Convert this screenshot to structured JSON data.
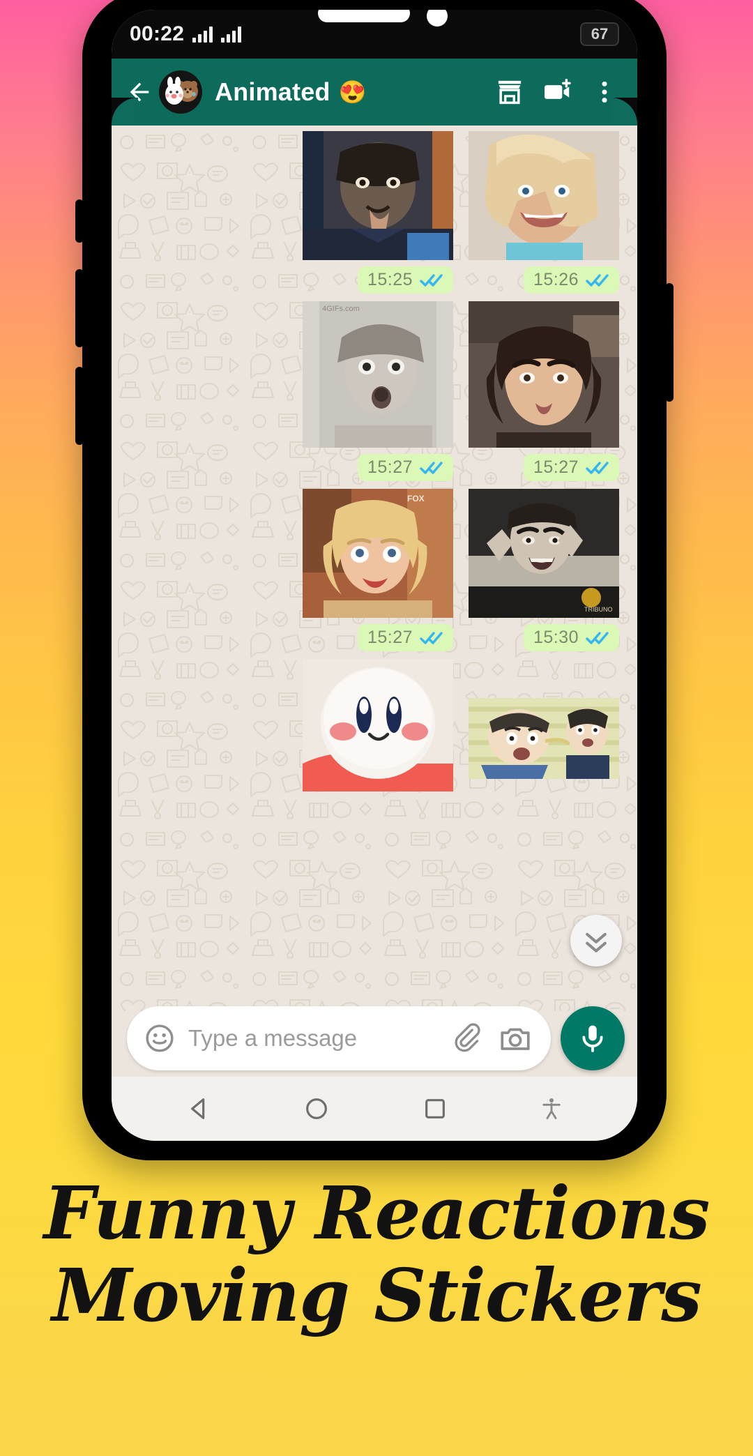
{
  "status_bar": {
    "clock": "00:22",
    "battery": "67",
    "signal_icon": "signal-bars-icon",
    "signal_icon_2": "signal-bars-icon"
  },
  "app_bar": {
    "back_icon": "back-arrow-icon",
    "avatar_name": "avatar",
    "title": "Animated",
    "title_emoji": "😍",
    "actions": [
      {
        "name": "sticker-store-icon",
        "label": "Store"
      },
      {
        "name": "video-call-add-icon",
        "label": "Video call"
      },
      {
        "name": "overflow-menu-icon",
        "label": "More options"
      }
    ]
  },
  "chat": {
    "background_pattern": "whatsapp-doodle-pattern",
    "accent_green": "#0d6b5c",
    "bubble_green": "#dbf8b7",
    "tick_blue": "#34b7f1",
    "rows": [
      {
        "left": {
          "sticker": "man-licking-fingers-sticker",
          "time": "15:25",
          "ticks": "read"
        },
        "right": {
          "sticker": "woman-shaking-head-sticker",
          "time": "15:26",
          "ticks": "read"
        }
      },
      {
        "left": {
          "sticker": "surprised-girl-sticker",
          "time": "15:27",
          "ticks": "read",
          "watermark": "4GIFs.com"
        },
        "right": {
          "sticker": "unimpressed-woman-sticker",
          "time": "15:27",
          "ticks": "read"
        }
      },
      {
        "left": {
          "sticker": "eye-roll-blonde-sticker",
          "time": "15:27",
          "ticks": "read",
          "watermark": "FOX"
        },
        "right": {
          "sticker": "angry-kid-sticker",
          "time": "15:30",
          "ticks": "read"
        }
      },
      {
        "left": {
          "sticker": "kirby-plush-sticker",
          "time": "",
          "ticks": ""
        },
        "right": {
          "sticker": "anime-shocked-sticker",
          "time": "",
          "ticks": ""
        }
      }
    ],
    "scroll_to_bottom_icon": "double-chevron-down-icon"
  },
  "composer": {
    "emoji_icon": "emoji-smiley-icon",
    "placeholder": "Type a message",
    "value": "",
    "attach_icon": "paperclip-icon",
    "camera_icon": "camera-icon",
    "mic_icon": "microphone-icon",
    "mic_button_color": "#007a66"
  },
  "nav_bar": {
    "items": [
      {
        "name": "nav-back-triangle-icon"
      },
      {
        "name": "nav-home-circle-icon"
      },
      {
        "name": "nav-recents-square-icon"
      },
      {
        "name": "nav-accessibility-icon"
      }
    ]
  },
  "promo": {
    "line1": "Funny Reactions",
    "line2": "Moving Stickers"
  }
}
